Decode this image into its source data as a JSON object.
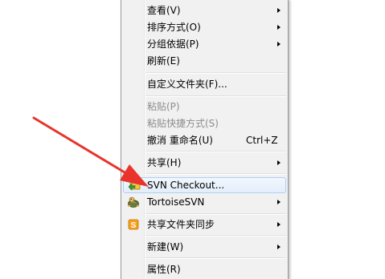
{
  "menu": {
    "view": "查看(V)",
    "sort": "排序方式(O)",
    "group": "分组依据(P)",
    "refresh": "刷新(E)",
    "customize": "自定义文件夹(F)...",
    "paste": "粘贴(P)",
    "paste_shortcut": "粘贴快捷方式(S)",
    "undo": "撤消 重命名(U)",
    "undo_shortcut": "Ctrl+Z",
    "share": "共享(H)",
    "svn_checkout": "SVN Checkout...",
    "tortoisesvn": "TortoiseSVN",
    "share_sync": "共享文件夹同步",
    "new": "新建(W)",
    "properties": "属性(R)"
  },
  "icons": {
    "svn_checkout": "svn-checkout-icon",
    "tortoisesvn": "tortoise-icon",
    "share_sync": "sync-icon"
  },
  "colors": {
    "arrow": "#e8342c",
    "highlight_border": "#aecff7",
    "menu_bg": "#f1f1f1"
  }
}
